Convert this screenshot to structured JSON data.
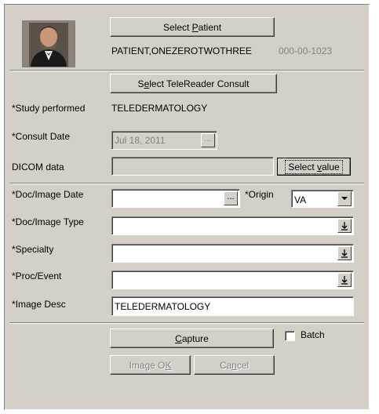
{
  "patient": {
    "select_button_label_pre": "Select ",
    "select_button_label_u": "P",
    "select_button_label_post": "atient",
    "name": "PATIENT,ONEZEROTWOTHREE",
    "ssn": "000-00-1023",
    "photo_icon": "patient-photo"
  },
  "consult": {
    "select_button_label_pre": "S",
    "select_button_label_u": "e",
    "select_button_label_post": "lect TeleReader Consult",
    "study_label": "*Study performed",
    "study_value": "TELEDERMATOLOGY",
    "date_label": "*Consult Date",
    "date_value": "Jul 18, 2011",
    "dicom_label": "DICOM data",
    "dicom_value": "",
    "select_value_pre": "Select ",
    "select_value_u": "v",
    "select_value_post": "alue"
  },
  "form": {
    "doc_date_label": "*Doc/Image Date",
    "doc_date_value": "",
    "origin_label": "*Origin",
    "origin_value": "VA",
    "doc_type_label": "*Doc/Image Type",
    "doc_type_value": "",
    "specialty_label": "*Specialty",
    "specialty_value": "",
    "proc_label": "*Proc/Event",
    "proc_value": "",
    "image_desc_label": "*Image Desc",
    "image_desc_value": "TELEDERMATOLOGY",
    "ellipsis": "..."
  },
  "actions": {
    "capture_u": "C",
    "capture_rest": "apture",
    "batch_label": "Batch",
    "batch_checked": false,
    "image_ok_pre": "Image O",
    "image_ok_u": "K",
    "cancel_pre": "Ca",
    "cancel_u": "n",
    "cancel_post": "cel"
  }
}
